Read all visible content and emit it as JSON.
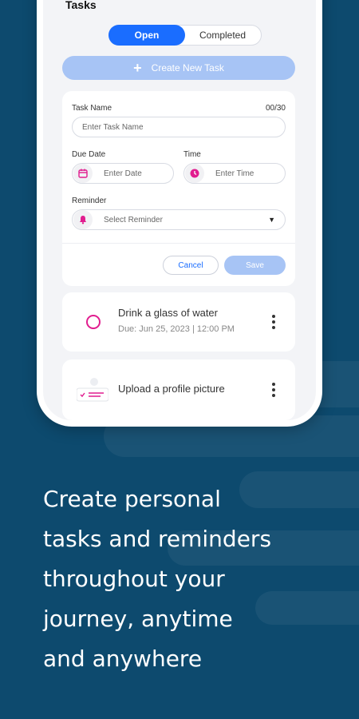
{
  "screen": {
    "title": "Tasks",
    "tabs": [
      {
        "label": "Open",
        "active": true
      },
      {
        "label": "Completed",
        "active": false
      }
    ],
    "create_button": "Create New Task"
  },
  "form": {
    "task_name_label": "Task Name",
    "task_name_counter": "00/30",
    "task_name_placeholder": "Enter Task Name",
    "due_date_label": "Due Date",
    "due_date_placeholder": "Enter Date",
    "time_label": "Time",
    "time_placeholder": "Enter Time",
    "reminder_label": "Reminder",
    "reminder_placeholder": "Select Reminder",
    "cancel_label": "Cancel",
    "save_label": "Save"
  },
  "tasks": [
    {
      "title": "Drink a glass of water",
      "due": "Due: Jun 25, 2023  |  12:00 PM",
      "icon": "circle-checkbox-icon"
    },
    {
      "title": "Upload a profile picture",
      "icon": "profile-card-icon"
    }
  ],
  "headline": [
    "Create personal",
    "tasks and reminders",
    "throughout your",
    "journey, anytime",
    "and anywhere"
  ],
  "colors": {
    "background": "#0d4a6e",
    "primary": "#1a6dff",
    "primary_disabled": "#a7c4f5",
    "accent": "#e11d8f"
  }
}
